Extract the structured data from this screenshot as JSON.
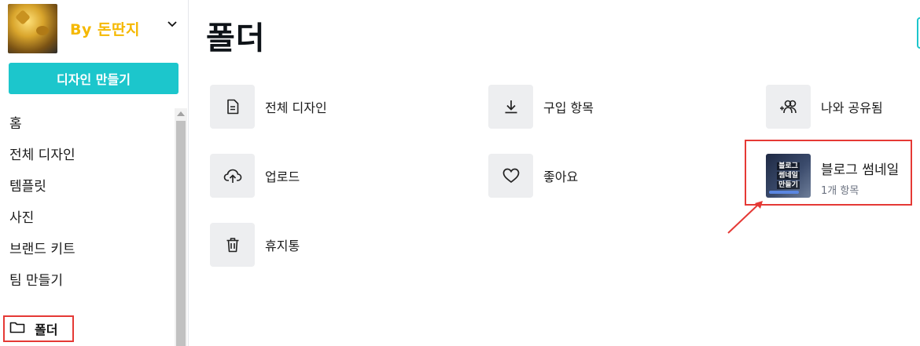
{
  "sidebar": {
    "brand": "By 돈딴지",
    "create_button": "디자인 만들기",
    "nav_items": [
      {
        "label": "홈"
      },
      {
        "label": "전체 디자인"
      },
      {
        "label": "템플릿"
      },
      {
        "label": "사진"
      },
      {
        "label": "브랜드 키트"
      },
      {
        "label": "팀 만들기"
      }
    ],
    "folders_label": "폴더"
  },
  "main": {
    "title": "폴더",
    "folders": [
      {
        "label": "전체 디자인",
        "icon": "document-icon"
      },
      {
        "label": "구입 항목",
        "icon": "download-icon"
      },
      {
        "label": "나와 공유됨",
        "icon": "shared-users-icon"
      },
      {
        "label": "업로드",
        "icon": "cloud-upload-icon"
      },
      {
        "label": "좋아요",
        "icon": "heart-icon"
      },
      {
        "label": "휴지통",
        "icon": "trash-icon"
      }
    ],
    "custom_folder": {
      "title": "블로그 썸네일",
      "subtitle": "1개 항목",
      "thumb_lines": [
        "블로그",
        "썸네일",
        "만들기"
      ]
    }
  },
  "colors": {
    "accent": "#1cc6cc",
    "brand": "#f5b800",
    "highlight": "#e53935"
  }
}
